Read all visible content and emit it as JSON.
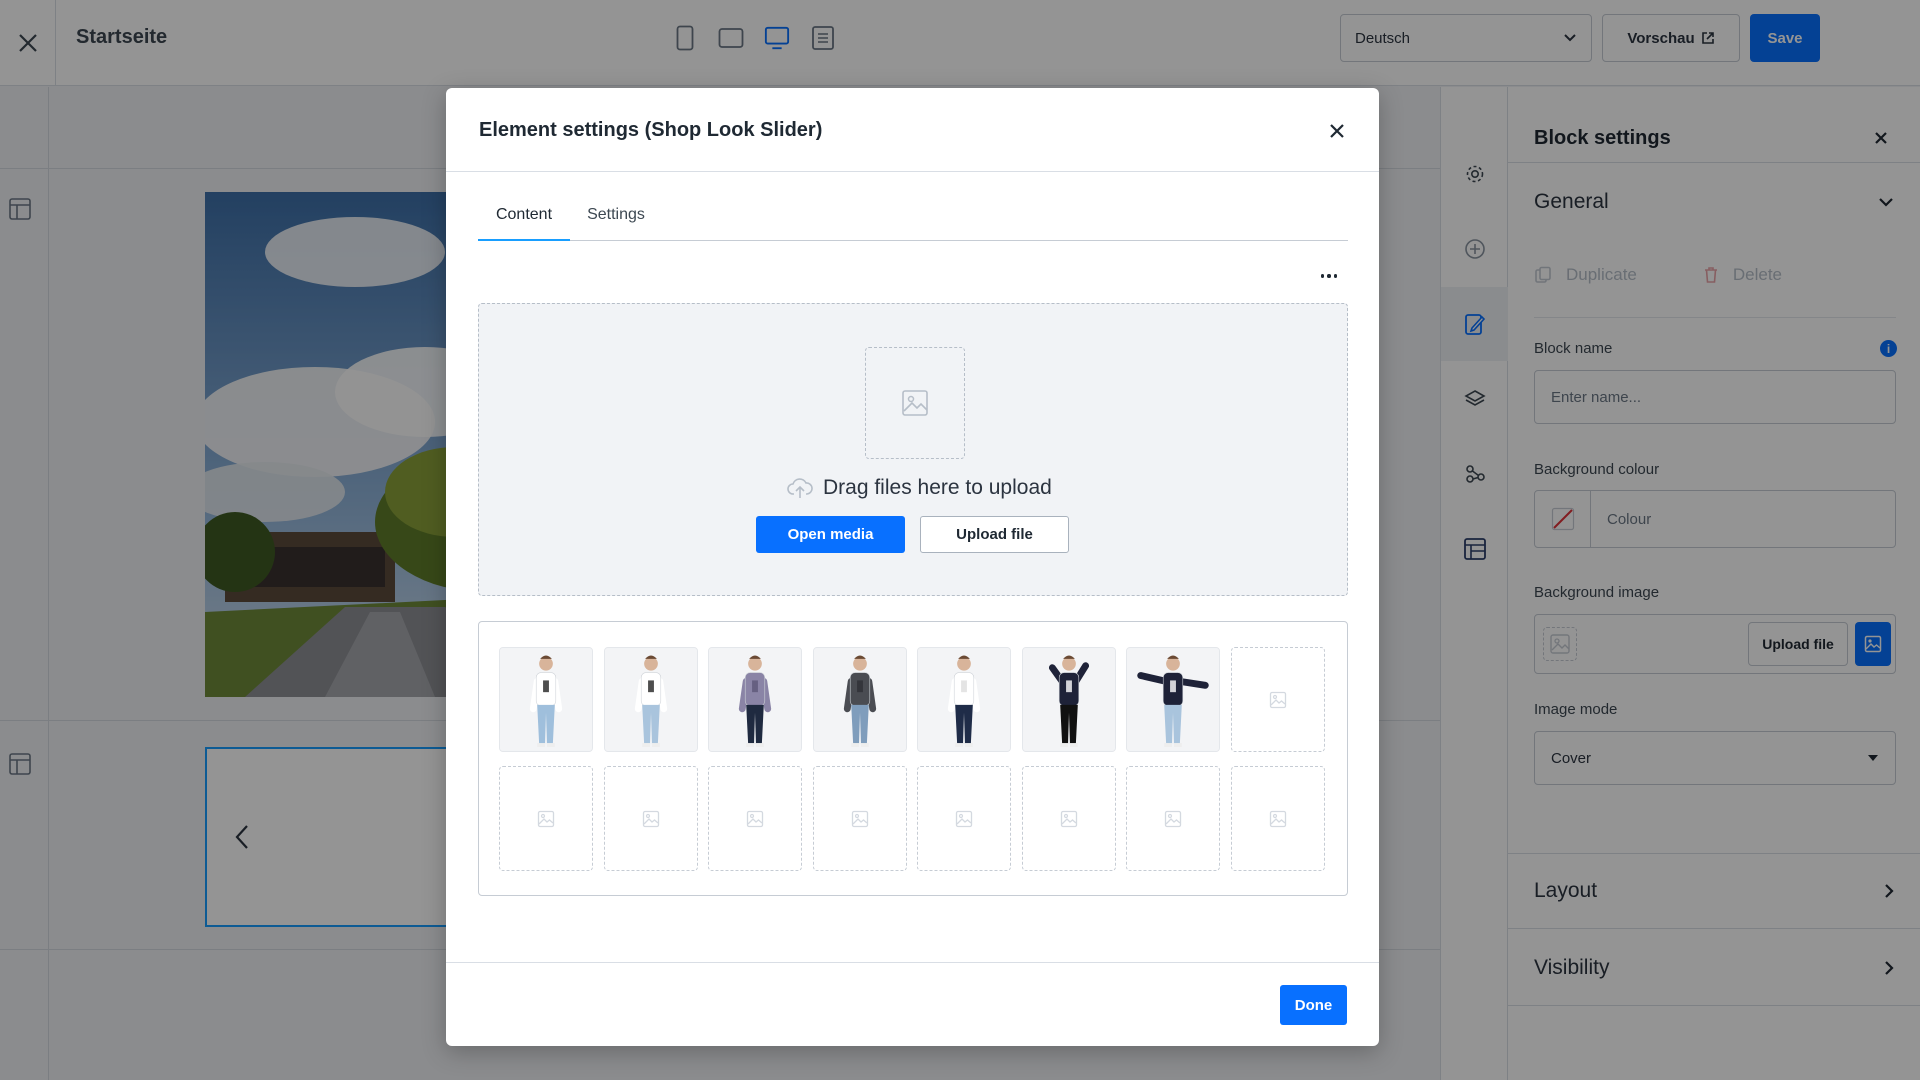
{
  "topbar": {
    "title": "Startseite",
    "language": "Deutsch",
    "preview_label": "Vorschau",
    "save_label": "Save"
  },
  "sidebar": {
    "title": "Block settings",
    "general_label": "General",
    "duplicate_label": "Duplicate",
    "delete_label": "Delete",
    "block_name_label": "Block name",
    "block_name_placeholder": "Enter name...",
    "help_icon_text": "i",
    "bg_colour_label": "Background colour",
    "colour_placeholder": "Colour",
    "bg_image_label": "Background image",
    "upload_file_label": "Upload file",
    "image_mode_label": "Image mode",
    "image_mode_value": "Cover",
    "layout_label": "Layout",
    "visibility_label": "Visibility"
  },
  "modal": {
    "title": "Element settings (Shop Look Slider)",
    "tabs": [
      {
        "label": "Content",
        "active": true
      },
      {
        "label": "Settings",
        "active": false
      }
    ],
    "dropzone_text": "Drag files here to upload",
    "open_media_label": "Open media",
    "upload_file_label": "Upload file",
    "done_label": "Done",
    "gallery": [
      {
        "kind": "model",
        "top": "#ffffff",
        "bottom": "#9fbfdc",
        "accent": "#222222",
        "arms": "down"
      },
      {
        "kind": "model",
        "top": "#ffffff",
        "bottom": "#a9c4dd",
        "accent": "#222222",
        "arms": "down"
      },
      {
        "kind": "model",
        "top": "#8a84a6",
        "bottom": "#1f2a40",
        "accent": "#5c5878",
        "arms": "down"
      },
      {
        "kind": "model",
        "top": "#4a4c52",
        "bottom": "#7f9dbc",
        "accent": "#2e3036",
        "arms": "down"
      },
      {
        "kind": "model",
        "top": "#ffffff",
        "bottom": "#1f2c48",
        "accent": "#dddddd",
        "arms": "down"
      },
      {
        "kind": "model",
        "top": "#1e2238",
        "bottom": "#111111",
        "accent": "#ffffff",
        "arms": "up"
      },
      {
        "kind": "model",
        "top": "#1e2238",
        "bottom": "#a9c4dd",
        "accent": "#ffffff",
        "arms": "wide"
      },
      {
        "kind": "empty"
      },
      {
        "kind": "empty"
      },
      {
        "kind": "empty"
      },
      {
        "kind": "empty"
      },
      {
        "kind": "empty"
      },
      {
        "kind": "empty"
      },
      {
        "kind": "empty"
      },
      {
        "kind": "empty"
      },
      {
        "kind": "empty"
      }
    ]
  },
  "colors": {
    "accent": "#0870ff",
    "selection": "#189eff"
  }
}
